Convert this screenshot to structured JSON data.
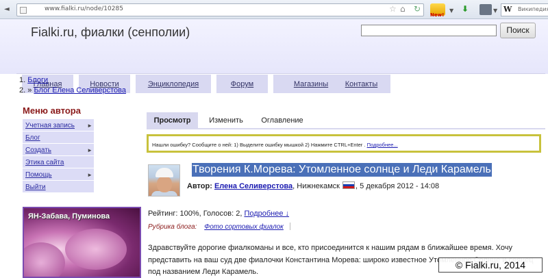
{
  "browser": {
    "url": "www.fialki.ru/node/10285",
    "search_engine_label": "Википедия (ru)",
    "addon_badge": "New!"
  },
  "site": {
    "title": "Fialki.ru, фиалки (сенполии)",
    "search_button": "Поиск",
    "search_placeholder": ""
  },
  "nav": [
    {
      "label": "Главная"
    },
    {
      "label": "Новости"
    },
    {
      "label": "Энциклопедия"
    },
    {
      "label": "Форум"
    },
    {
      "label": "Магазины"
    },
    {
      "label": "Контакты"
    }
  ],
  "breadcrumb": [
    {
      "num": "1.",
      "text": "Блоги"
    },
    {
      "num": "2.",
      "prefix": "» ",
      "text": "Блог Елена Селиверстова"
    }
  ],
  "sidebar": {
    "title": "Меню автора",
    "items": [
      {
        "label": "Учетная запись",
        "arrow": "►"
      },
      {
        "label": "Блог",
        "arrow": ""
      },
      {
        "label": "Создать",
        "arrow": "►"
      },
      {
        "label": "Этика сайта",
        "arrow": ""
      },
      {
        "label": "Помощь",
        "arrow": "►"
      },
      {
        "label": "Выйти",
        "arrow": ""
      }
    ],
    "promo_caption": "ЯН-Забава, Пуминова"
  },
  "tabs": [
    {
      "label": "Просмотр",
      "active": true
    },
    {
      "label": "Изменить",
      "active": false
    },
    {
      "label": "Оглавление",
      "active": false
    }
  ],
  "notice": {
    "text": "Нашли ошибку? Сообщите о ней: 1) Выделите ошибку мышкой 2) Нажмите CTRL+Enter  . ",
    "link": "Подробнее..."
  },
  "article": {
    "title": "Творения К.Морева: Утомленное солнце и Леди Карамель",
    "author_label": "Автор:",
    "author": "Елена Селиверстова",
    "location": ", Нижнекамск",
    "date": ", 5 декабря 2012 - 14:08",
    "rating_text": "Рейтинг: 100%, Голосов: 2, ",
    "rating_link": "Подробнее ↓",
    "rubric_label": "Рубрика блога:",
    "rubric_link": "Фото сортовых фиалок",
    "body": "Здравствуйте дорогие фиалкоманы и все, кто присоединится к нашим рядам в ближайшее время. Хочу представить на ваш суд две фиалочки Константина Морева: широко известное Утомленное Солнце и сеянец под названием Леди Карамель."
  },
  "copyright": "© Fialki.ru, 2014"
}
